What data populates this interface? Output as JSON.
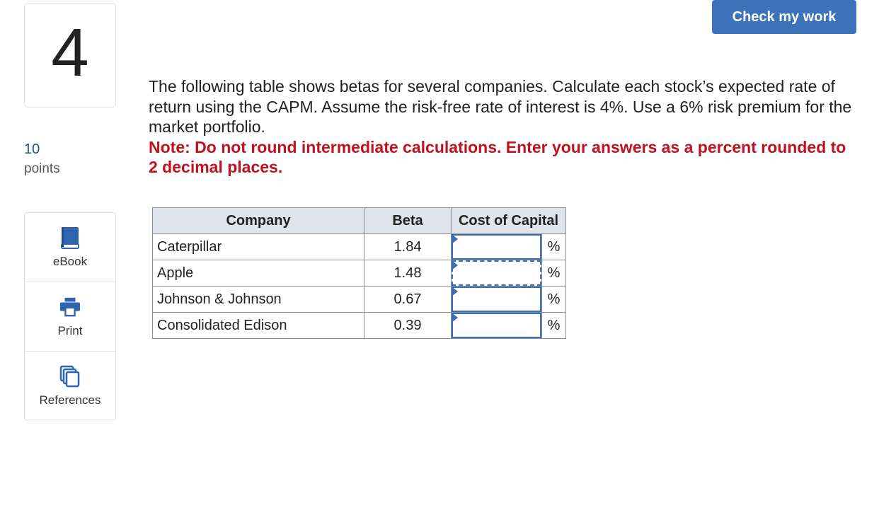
{
  "question": {
    "number": "4",
    "points_value": "10",
    "points_label": "points",
    "text": "The following table shows betas for several companies. Calculate each stock’s expected rate of return using the CAPM. Assume the risk-free rate of interest is 4%. Use a 6% risk premium for the market portfolio.",
    "note": "Note: Do not round intermediate calculations. Enter your answers as a percent rounded to 2 decimal places."
  },
  "header": {
    "check_label": "Check my work",
    "accent_color": "#3b72b9"
  },
  "tools": [
    {
      "label": "eBook",
      "icon": "book-icon"
    },
    {
      "label": "Print",
      "icon": "printer-icon"
    },
    {
      "label": "References",
      "icon": "copy-icon"
    }
  ],
  "table": {
    "headers": {
      "company": "Company",
      "beta": "Beta",
      "cost": "Cost of Capital"
    },
    "rows": [
      {
        "company": "Caterpillar",
        "beta": "1.84",
        "value": "",
        "unit": "%"
      },
      {
        "company": "Apple",
        "beta": "1.48",
        "value": "",
        "unit": "%"
      },
      {
        "company": "Johnson & Johnson",
        "beta": "0.67",
        "value": "",
        "unit": "%"
      },
      {
        "company": "Consolidated Edison",
        "beta": "0.39",
        "value": "",
        "unit": "%"
      }
    ]
  },
  "colors": {
    "note": "#c0121f",
    "points": "#1b4f8c",
    "header_bg": "#dfe3ec"
  }
}
